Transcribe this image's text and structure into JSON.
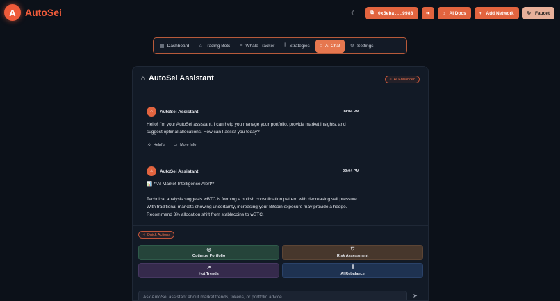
{
  "brand": {
    "letter": "A",
    "name": "AutoSei"
  },
  "topbar": {
    "wallet": "0x5eba...9988",
    "docs": "AI Docs",
    "add_network": "Add Network",
    "faucet": "Faucet"
  },
  "nav": {
    "tabs": [
      {
        "label": "Dashboard"
      },
      {
        "label": "Trading Bots"
      },
      {
        "label": "Whale Tracker"
      },
      {
        "label": "Strategies"
      },
      {
        "label": "AI Chat"
      },
      {
        "label": "Settings"
      }
    ]
  },
  "chat": {
    "title": "AutoSei Assistant",
    "badge": "AI Enhanced",
    "messages": [
      {
        "sender": "AutoSei Assistant",
        "time": "09:04 PM",
        "text": "Hello! I'm your AutoSei assistant. I can help you manage your portfolio, provide market insights, and suggest optimal allocations. How can I assist you today?",
        "actions": [
          "Helpful",
          "More Info"
        ]
      },
      {
        "sender": "AutoSei Assistant",
        "time": "09:04 PM",
        "headline": "📊 **AI Market Intelligence Alert**",
        "text": "Technical analysis suggests wBTC is forming a bullish consolidation pattern with decreasing sell pressure. With traditional markets showing uncertainty, increasing your Bitcoin exposure may provide a hedge. Recommend 3% allocation shift from stablecoins to wBTC."
      }
    ],
    "quick_actions_label": "Quick Actions",
    "quick_actions": [
      "Optimize Portfolio",
      "Risk Assessment",
      "Hot Trends",
      "AI Rebalance"
    ],
    "input_placeholder": "Ask AutoSei assistant about market trends, tokens, or portfolio advice..."
  }
}
